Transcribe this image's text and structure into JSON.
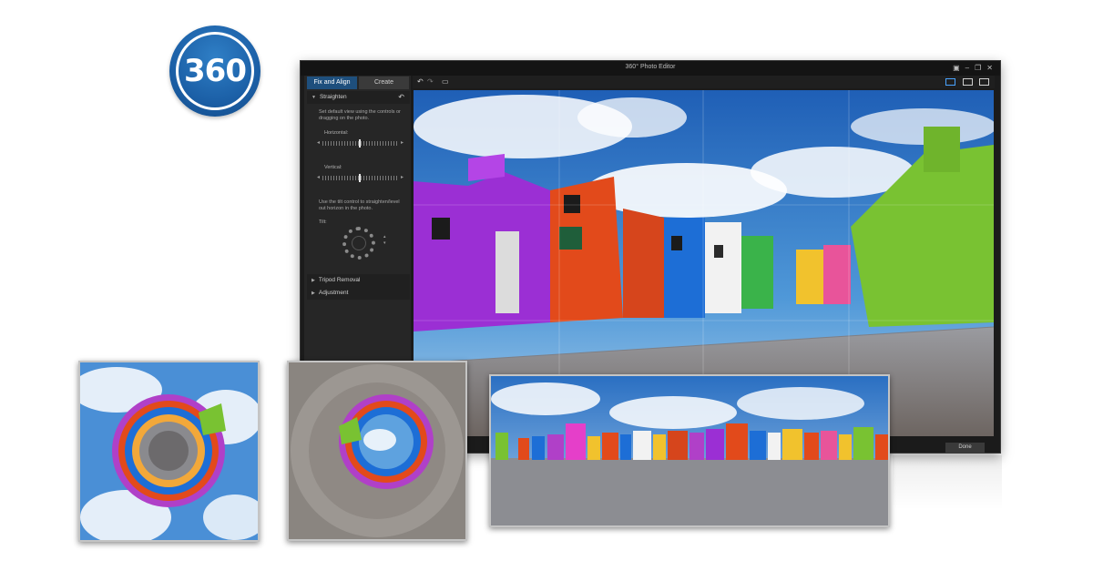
{
  "logo": {
    "text": "360"
  },
  "window": {
    "title": "360° Photo Editor",
    "controls": [
      "restore-icon",
      "minimize-icon",
      "maximize-icon",
      "close-icon"
    ]
  },
  "left_panel": {
    "tabs": [
      {
        "label": "Fix and Align",
        "active": true
      },
      {
        "label": "Create",
        "active": false
      }
    ],
    "sections": [
      {
        "label": "Straighten",
        "expanded": true
      },
      {
        "label": "Tripod Removal",
        "expanded": false
      },
      {
        "label": "Adjustment",
        "expanded": false
      }
    ],
    "straighten": {
      "instruction": "Set default view using the controls or dragging on the photo.",
      "horizontal_label": "Horizontal:",
      "vertical_label": "Vertical:",
      "tilt_instruction": "Use the tilt control to straighten/level out horizon in the photo.",
      "tilt_label": "Tilt:"
    }
  },
  "toolbar": {
    "left_icons": [
      "undo-icon",
      "redo-icon",
      "panorama-view-icon"
    ],
    "right_icons": [
      "grid-toggle-icon",
      "single-view-icon",
      "compare-view-icon"
    ]
  },
  "footer": {
    "done_label": "Done"
  },
  "colors": {
    "accent": "#1e4f7d",
    "logo_blue": "#1b5fa6",
    "panel_bg": "#262626",
    "window_bg": "#1b1b1b"
  }
}
